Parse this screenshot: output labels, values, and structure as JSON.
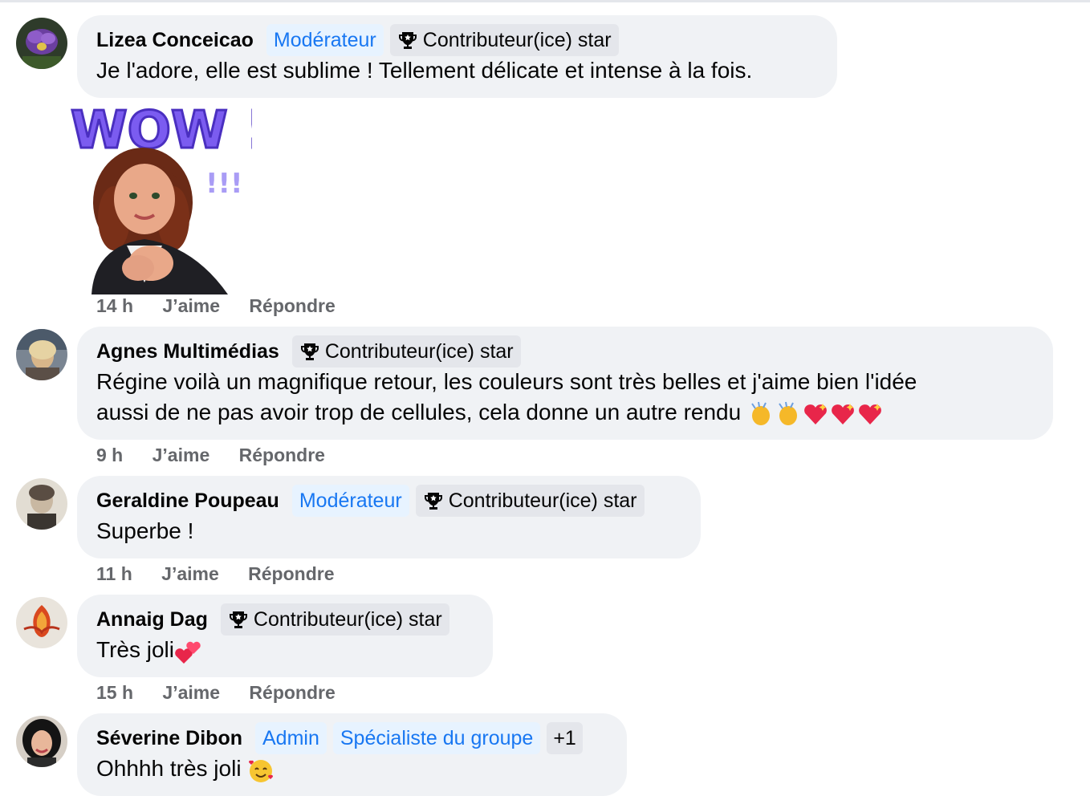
{
  "comments": [
    {
      "author": "Lizea Conceicao",
      "badges": {
        "role1": "Modérateur",
        "star": "Contributeur(ice) star"
      },
      "text": "Je l'adore, elle est sublime ! Tellement délicate et intense à la fois.",
      "sticker": {
        "text": "WOW !",
        "extra": "!!!"
      },
      "time": "14 h",
      "like": "J’aime",
      "reply": "Répondre"
    },
    {
      "author": "Agnes Multimédias",
      "badges": {
        "star": "Contributeur(ice) star"
      },
      "text_line1": "Régine voilà un magnifique retour, les couleurs sont très belles et j'aime bien l'idée",
      "text_line2": "aussi de ne pas avoir trop de cellules, cela donne un autre rendu",
      "emojis": [
        "clapping-hands",
        "clapping-hands",
        "sparkling-heart",
        "sparkling-heart",
        "sparkling-heart"
      ],
      "time": "9 h",
      "like": "J’aime",
      "reply": "Répondre"
    },
    {
      "author": "Geraldine Poupeau",
      "badges": {
        "role1": "Modérateur",
        "star": "Contributeur(ice) star"
      },
      "text": "Superbe !",
      "time": "11 h",
      "like": "J’aime",
      "reply": "Répondre"
    },
    {
      "author": "Annaig Dag",
      "badges": {
        "star": "Contributeur(ice) star"
      },
      "text": "Très joli",
      "emojis": [
        "two-hearts"
      ],
      "time": "15 h",
      "like": "J’aime",
      "reply": "Répondre"
    },
    {
      "author": "Séverine Dibon",
      "badges": {
        "role1": "Admin",
        "role2": "Spécialiste du groupe",
        "more": "+1"
      },
      "text": "Ohhhh très joli",
      "emojis": [
        "smiling-face-with-hearts"
      ],
      "time": "",
      "like": "",
      "reply": ""
    }
  ],
  "colors": {
    "bubble": "#f0f2f5",
    "role_badge_bg": "#e7f3ff",
    "role_badge_text": "#1877f2",
    "star_badge_bg": "#e4e6eb",
    "meta_text": "#65676b"
  }
}
